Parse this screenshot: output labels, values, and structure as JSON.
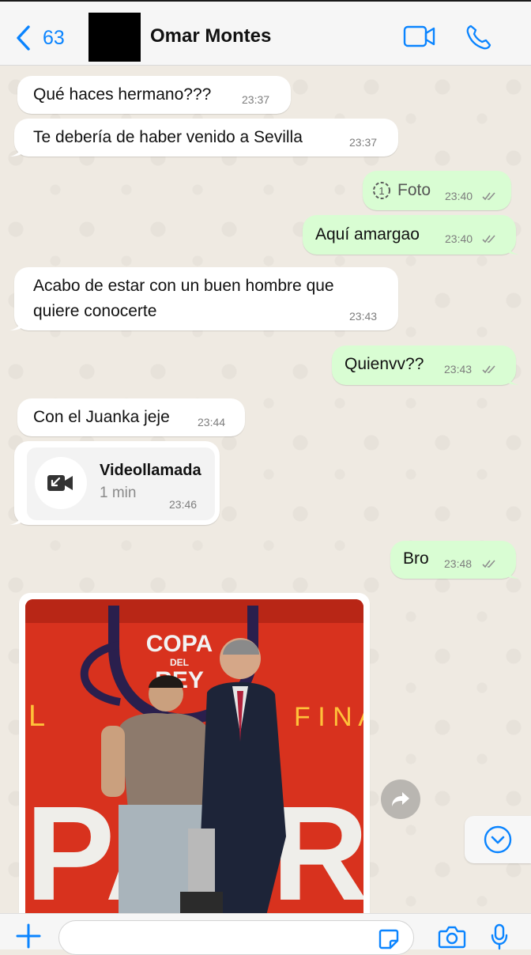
{
  "header": {
    "back_count": "63",
    "contact_name": "Omar Montes"
  },
  "messages": [
    {
      "text": "Qué haces hermano???",
      "time": "23:37"
    },
    {
      "text": "Te debería de haber venido a Sevilla",
      "time": "23:37"
    },
    {
      "text": "Foto",
      "time": "23:40"
    },
    {
      "text": "Aquí amargao",
      "time": "23:40"
    },
    {
      "text_line1": "Acabo de estar con un buen hombre que",
      "text_line2": "quiere conocerte",
      "time": "23:43"
    },
    {
      "text": "Quienvv??",
      "time": "23:43"
    },
    {
      "text": "Con el Juanka jeje",
      "time": "23:44"
    },
    {
      "title": "Videollamada",
      "duration": "1 min",
      "time": "23:46"
    },
    {
      "text": "Bro",
      "time": "23:48"
    }
  ],
  "photo": {
    "logo_line1": "COPA",
    "logo_line2": "DEL",
    "logo_line3": "REY",
    "wall_left": "L",
    "wall_right": "F I N A",
    "letters": "PA  RE"
  },
  "composer": {
    "placeholder": ""
  },
  "colors": {
    "accent": "#0a84ff",
    "incoming_bubble": "#ffffff",
    "outgoing_bubble": "#d9fdd3",
    "wallpaper": "#efeae2",
    "read_checks": "#8e8e8e"
  }
}
